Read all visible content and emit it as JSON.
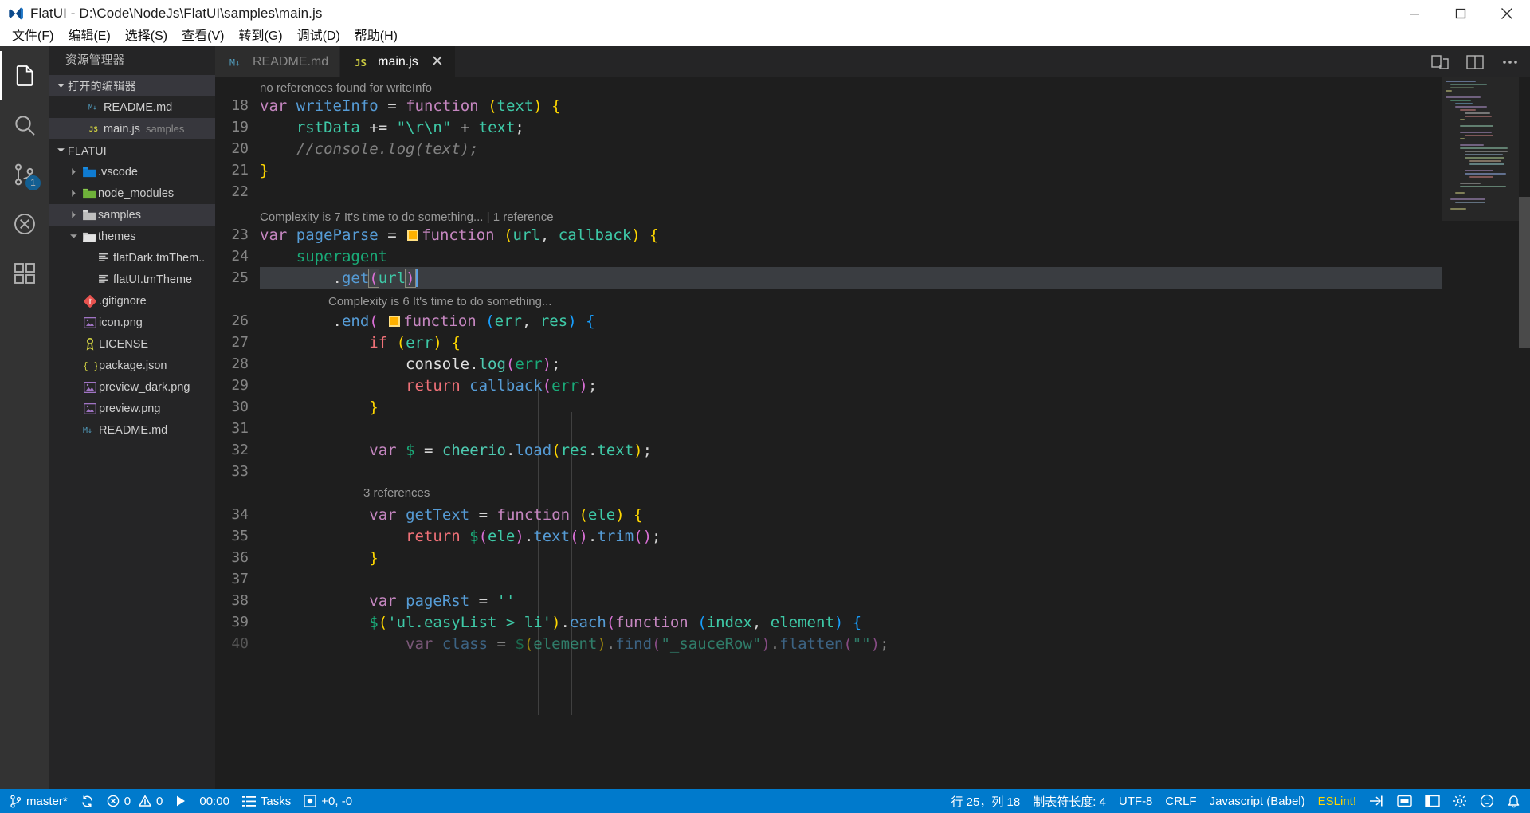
{
  "window": {
    "title": "FlatUI - D:\\Code\\NodeJs\\FlatUI\\samples\\main.js",
    "logo_icon": "vscode-logo-icon",
    "minimize_label": "Minimize",
    "maximize_label": "Maximize",
    "close_label": "Close"
  },
  "menubar": {
    "items": [
      {
        "label": "文件(F)",
        "name": "menu-file"
      },
      {
        "label": "编辑(E)",
        "name": "menu-edit"
      },
      {
        "label": "选择(S)",
        "name": "menu-selection"
      },
      {
        "label": "查看(V)",
        "name": "menu-view"
      },
      {
        "label": "转到(G)",
        "name": "menu-go"
      },
      {
        "label": "调试(D)",
        "name": "menu-debug"
      },
      {
        "label": "帮助(H)",
        "name": "menu-help"
      }
    ]
  },
  "activitybar": {
    "items": [
      {
        "name": "activity-explorer",
        "icon": "files-icon",
        "active": true,
        "badge": null
      },
      {
        "name": "activity-search",
        "icon": "search-icon",
        "active": false,
        "badge": null
      },
      {
        "name": "activity-source-control",
        "icon": "source-control-icon",
        "active": false,
        "badge": "1"
      },
      {
        "name": "activity-debug",
        "icon": "debug-icon",
        "active": false,
        "badge": null
      },
      {
        "name": "activity-extensions",
        "icon": "extensions-icon",
        "active": false,
        "badge": null
      }
    ]
  },
  "sidebar": {
    "title": "资源管理器",
    "open_editors": {
      "label": "打开的编辑器",
      "expanded": true,
      "items": [
        {
          "label": "README.md",
          "icon": "markdown-icon",
          "sub": "",
          "selected": false
        },
        {
          "label": "main.js",
          "icon": "js-icon",
          "sub": "samples",
          "selected": true
        }
      ]
    },
    "project": {
      "label": "FLATUI",
      "expanded": true,
      "items": [
        {
          "label": ".vscode",
          "icon": "folder-blue-icon",
          "type": "folder",
          "expanded": false,
          "depth": 1,
          "selected": false
        },
        {
          "label": "node_modules",
          "icon": "folder-green-icon",
          "type": "folder",
          "expanded": false,
          "depth": 1,
          "selected": false
        },
        {
          "label": "samples",
          "icon": "folder-grey-icon",
          "type": "folder",
          "expanded": false,
          "depth": 1,
          "selected": true
        },
        {
          "label": "themes",
          "icon": "folder-open-icon",
          "type": "folder",
          "expanded": true,
          "depth": 1,
          "selected": false
        },
        {
          "label": "flatDark.tmThem..",
          "icon": "theme-file-icon",
          "type": "file",
          "depth": 2,
          "selected": false
        },
        {
          "label": "flatUI.tmTheme",
          "icon": "theme-file-icon",
          "type": "file",
          "depth": 2,
          "selected": false
        },
        {
          "label": ".gitignore",
          "icon": "git-icon",
          "type": "file",
          "depth": 1,
          "selected": false
        },
        {
          "label": "icon.png",
          "icon": "image-icon",
          "type": "file",
          "depth": 1,
          "selected": false
        },
        {
          "label": "LICENSE",
          "icon": "license-icon",
          "type": "file",
          "depth": 1,
          "selected": false
        },
        {
          "label": "package.json",
          "icon": "json-icon",
          "type": "file",
          "depth": 1,
          "selected": false
        },
        {
          "label": "preview_dark.png",
          "icon": "image-icon",
          "type": "file",
          "depth": 1,
          "selected": false
        },
        {
          "label": "preview.png",
          "icon": "image-icon",
          "type": "file",
          "depth": 1,
          "selected": false
        },
        {
          "label": "README.md",
          "icon": "markdown-icon",
          "type": "file",
          "depth": 1,
          "selected": false
        }
      ]
    }
  },
  "tabs": {
    "items": [
      {
        "label": "README.md",
        "icon": "markdown-icon",
        "active": false,
        "closable": false
      },
      {
        "label": "main.js",
        "icon": "js-icon",
        "active": true,
        "closable": true,
        "close_glyph": "✕"
      }
    ],
    "actions": [
      {
        "name": "open-changes-icon",
        "label": "Open Changes"
      },
      {
        "name": "split-editor-icon",
        "label": "Split Editor"
      },
      {
        "name": "more-actions-icon",
        "label": "More Actions..."
      }
    ]
  },
  "editor": {
    "first_visible_line": 18,
    "cursor_line": 25,
    "cursor_column": 18,
    "lines": [
      {
        "no": 18,
        "text": "var writeInfo = function (text) {"
      },
      {
        "no": 19,
        "text": "    rstData += \"\\r\\n\" + text;"
      },
      {
        "no": 20,
        "text": "    //console.log(text);"
      },
      {
        "no": 21,
        "text": "}"
      },
      {
        "no": 22,
        "text": ""
      },
      {
        "no": 23,
        "text": "var pageParse = ▣ function (url, callback) {"
      },
      {
        "no": 24,
        "text": "    superagent"
      },
      {
        "no": 25,
        "text": "        .get(url)"
      },
      {
        "no": 26,
        "text": "        .end( ▣ function (err, res) {"
      },
      {
        "no": 27,
        "text": "            if (err) {"
      },
      {
        "no": 28,
        "text": "                console.log(err);"
      },
      {
        "no": 29,
        "text": "                return callback(err);"
      },
      {
        "no": 30,
        "text": "            }"
      },
      {
        "no": 31,
        "text": ""
      },
      {
        "no": 32,
        "text": "            var $ = cheerio.load(res.text);"
      },
      {
        "no": 33,
        "text": ""
      },
      {
        "no": 34,
        "text": "            var getText = function (ele) {"
      },
      {
        "no": 35,
        "text": "                return $(ele).text().trim();"
      },
      {
        "no": 36,
        "text": "            }"
      },
      {
        "no": 37,
        "text": ""
      },
      {
        "no": 38,
        "text": "            var pageRst = ''"
      },
      {
        "no": 39,
        "text": "            $('ul.easyList > li').each(function (index, element) {"
      },
      {
        "no": 40,
        "text": "                var class = $(element).find(\"_sauceRow\").flatten(\"\");"
      }
    ],
    "codelens": [
      {
        "above_line": 18,
        "text": "no references found for writeInfo"
      },
      {
        "above_line": 23,
        "text": "Complexity is 7 It's time to do something... | 1 reference"
      },
      {
        "above_line": 26,
        "text": "Complexity is 6 It's time to do something..."
      },
      {
        "above_line": 34,
        "text": "3 references"
      }
    ]
  },
  "statusbar": {
    "left": [
      {
        "name": "status-branch",
        "icon": "source-control-branch-icon",
        "label": "master*"
      },
      {
        "name": "status-sync",
        "icon": "sync-icon",
        "label": ""
      },
      {
        "name": "status-problems",
        "icon": "error-warning-icon",
        "label": "0",
        "label2": "0"
      },
      {
        "name": "status-run",
        "icon": "play-icon",
        "label": ""
      },
      {
        "name": "status-timer",
        "icon": "",
        "label": "00:00"
      },
      {
        "name": "status-tasks",
        "icon": "list-icon",
        "label": "Tasks"
      },
      {
        "name": "status-diff",
        "icon": "record-icon",
        "label": "+0, -0"
      }
    ],
    "right": [
      {
        "name": "status-cursor-position",
        "label": "行 25，列 18"
      },
      {
        "name": "status-indent",
        "label": "制表符长度: 4"
      },
      {
        "name": "status-encoding",
        "label": "UTF-8"
      },
      {
        "name": "status-eol",
        "label": "CRLF"
      },
      {
        "name": "status-language-mode",
        "label": "Javascript (Babel)"
      },
      {
        "name": "status-eslint",
        "label": "ESLint!"
      },
      {
        "name": "status-send-icon",
        "label": "",
        "icon": "send-icon"
      },
      {
        "name": "status-screencast-icon",
        "label": "",
        "icon": "screencast-icon"
      },
      {
        "name": "status-layout-icon",
        "label": "",
        "icon": "layout-icon"
      },
      {
        "name": "status-settings-icon",
        "label": "",
        "icon": "gear-icon"
      },
      {
        "name": "status-feedback-icon",
        "label": "",
        "icon": "smiley-icon"
      },
      {
        "name": "status-bell-icon",
        "label": "",
        "icon": "bell-icon"
      }
    ]
  },
  "colors": {
    "accent": "#007acc",
    "titlebar_bg": "#ffffff",
    "activitybar_bg": "#333333",
    "sidebar_bg": "#252526",
    "editor_bg": "#1e1e1e",
    "selection_bg": "#3a3d41",
    "eslint_yellow": "#ffd602"
  }
}
